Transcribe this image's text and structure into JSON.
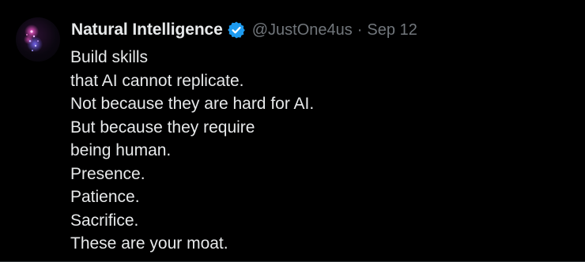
{
  "tweet": {
    "display_name": "Natural Intelligence",
    "handle": "@JustOne4us",
    "separator": "·",
    "date": "Sep 12",
    "verified": true,
    "verified_color": "#1d9bf0",
    "text_lines": [
      "Build skills",
      "that AI cannot replicate.",
      "Not because they are hard for AI.",
      "But because they require",
      "being human.",
      "Presence.",
      "Patience.",
      "Sacrifice.",
      "These are your moat."
    ]
  },
  "colors": {
    "background": "#000000",
    "primary_text": "#e7e9ea",
    "secondary_text": "#71767b"
  }
}
